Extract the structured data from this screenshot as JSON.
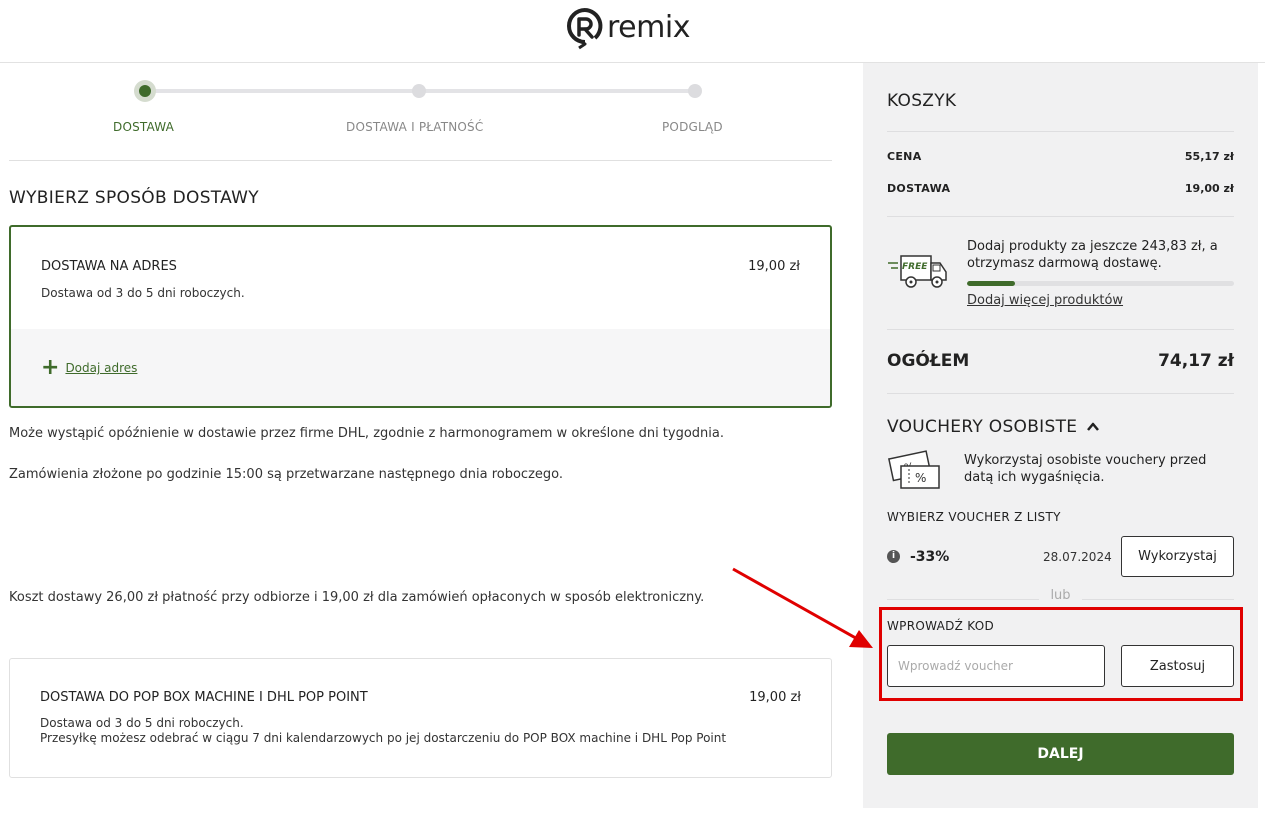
{
  "header": {
    "logo_text": "remix"
  },
  "stepper": {
    "steps": [
      {
        "label": "DOSTAWA",
        "state": "active"
      },
      {
        "label": "DOSTAWA I PŁATNOŚĆ",
        "state": "pending"
      },
      {
        "label": "PODGLĄD",
        "state": "pending"
      }
    ]
  },
  "main": {
    "title": "WYBIERZ SPOSÓB DOSTAWY",
    "option1": {
      "title": "DOSTAWA NA ADRES",
      "price": "19,00 zł",
      "description": "Dostawa od 3 do 5 dni roboczych.",
      "add_address": "Dodaj adres"
    },
    "notes": [
      "Może wystąpić opóźnienie w dostawie przez firme DHL, zgodnie z harmonogramem w określone dni tygodnia.",
      "Zamówienia złożone po godzinie 15:00 są przetwarzane następnego dnia roboczego.",
      "Koszt dostawy 26,00 zł płatność przy odbiorze i 19,00 zł dla zamówień opłaconych w sposób elektroniczny."
    ],
    "option2": {
      "title": "DOSTAWA DO POP BOX MACHINE I DHL POP POINT",
      "price": "19,00 zł",
      "description_line1": "Dostawa od 3 do 5 dni roboczych.",
      "description_line2": "Przesyłkę możesz odebrać w ciągu 7 dni kalendarzowych po jej dostarczeniu do POP BOX machine i DHL Pop Point"
    }
  },
  "cart": {
    "title": "KOSZYK",
    "price_label": "CENA",
    "price_value": "55,17 zł",
    "delivery_label": "DOSTAWA",
    "delivery_value": "19,00 zł",
    "free_icon_text": "FREE",
    "free_delivery_message": "Dodaj produkty za jeszcze 243,83 zł, a otrzymasz darmową dostawę.",
    "free_delivery_progress": 0.18,
    "add_more_link": "Dodaj więcej produktów",
    "total_label": "OGÓŁEM",
    "total_value": "74,17 zł"
  },
  "vouchers": {
    "title": "VOUCHERY OSOBISTE",
    "message": "Wykorzystaj osobiste vouchery przed datą ich wygaśnięcia.",
    "choose_label": "WYBIERZ VOUCHER Z LISTY",
    "items": [
      {
        "discount": "-33%",
        "expiry": "28.07.2024",
        "use_label": "Wykorzystaj"
      }
    ],
    "or_label": "lub",
    "code_label": "WPROWADŹ KOD",
    "code_placeholder": "Wprowadź voucher",
    "apply_label": "Zastosuj"
  },
  "next_button": "DALEJ",
  "colors": {
    "brand_green": "#3f6b2b",
    "highlight_red": "#e00000",
    "sidebar_bg": "#f1f1f2"
  }
}
